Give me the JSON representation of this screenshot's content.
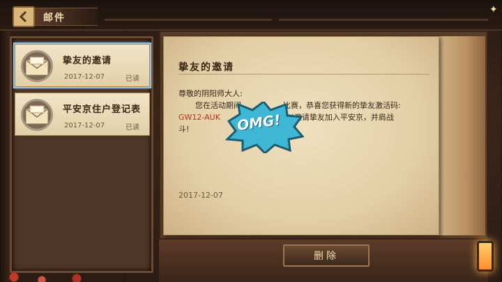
{
  "header": {
    "title": "邮件"
  },
  "mail_list": [
    {
      "subject": "挚友的邀请",
      "date": "2017-12-07",
      "status": "已读",
      "selected": true
    },
    {
      "subject": "平安京住户登记表",
      "date": "2017-12-07",
      "status": "已读",
      "selected": false
    }
  ],
  "letter": {
    "subject": "挚友的邀请",
    "greeting": "尊敬的阴阳师大人:",
    "line1_a": "您在活动期间",
    "line1_b": "比赛，恭喜您获得新的挚友激活码:",
    "code": "GW12-AUK",
    "line2": "可以邀请挚友加入平安京，并肩战",
    "line3": "斗!",
    "date": "2017-12-07"
  },
  "sticker": {
    "text": "OMG!"
  },
  "actions": {
    "delete_label": "删除"
  },
  "colors": {
    "accent": "#8fc3ea",
    "code": "#b03020",
    "sticker": "#3fb6d3"
  },
  "icons": [
    "back-arrow-icon",
    "envelope-icon",
    "lantern-icon"
  ]
}
